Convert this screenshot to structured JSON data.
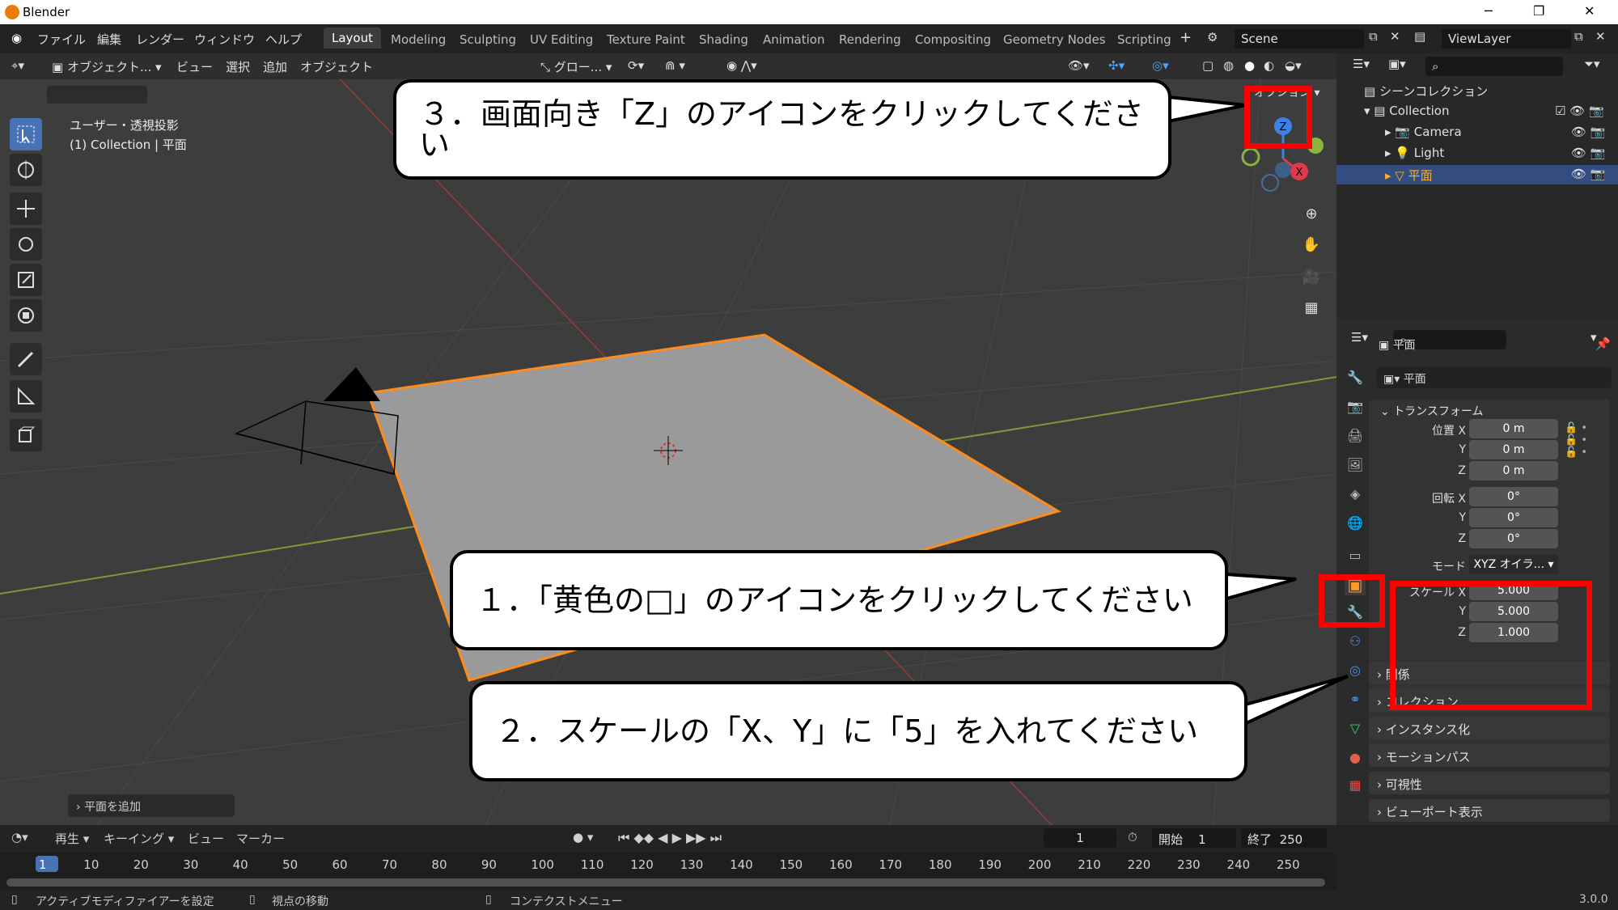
{
  "titlebar": {
    "title": "Blender",
    "minimize": "─",
    "maximize": "❐",
    "close": "✕"
  },
  "menu": [
    "ファイル",
    "編集",
    "レンダー",
    "ウィンドウ",
    "ヘルプ"
  ],
  "workspaces": [
    "Layout",
    "Modeling",
    "Sculpting",
    "UV Editing",
    "Texture Paint",
    "Shading",
    "Animation",
    "Rendering",
    "Compositing",
    "Geometry Nodes",
    "Scripting"
  ],
  "scene": "Scene",
  "view_layer": "ViewLayer",
  "viewport": {
    "mode": "オブジェクト...",
    "menus": [
      "ビュー",
      "選択",
      "追加",
      "オブジェクト"
    ],
    "orientation": "グロー...",
    "options": "オプション",
    "view_name": "ユーザー・透視投影",
    "collection_info": "(1) Collection | 平面",
    "last_op": "平面を追加",
    "gizmo": {
      "z": "Z",
      "x": "X"
    }
  },
  "outliner": {
    "root": "シーンコレクション",
    "collection": "Collection",
    "items": [
      "Camera",
      "Light",
      "平面"
    ]
  },
  "properties": {
    "object_name": "平面",
    "data_name": "平面",
    "transform": "トランスフォーム",
    "location_label": "位置 X",
    "rotation_label": "回転 X",
    "axis_y": "Y",
    "axis_z": "Z",
    "location": [
      "0 m",
      "0 m",
      "0 m"
    ],
    "rotation": [
      "0°",
      "0°",
      "0°"
    ],
    "mode_label": "モード",
    "mode_value": "XYZ オイラ...",
    "scale_label": "スケール X",
    "scale": [
      "5.000",
      "5.000",
      "1.000"
    ],
    "panels": [
      "関係",
      "コレクション",
      "インスタンス化",
      "モーションパス",
      "可視性",
      "ビューポート表示"
    ]
  },
  "timeline": {
    "menus": [
      "再生",
      "キーイング",
      "ビュー",
      "マーカー"
    ],
    "current_frame": "1",
    "start_label": "開始",
    "start": "1",
    "end_label": "終了",
    "end": "250",
    "ticks": [
      "1",
      "10",
      "20",
      "30",
      "40",
      "50",
      "60",
      "70",
      "80",
      "90",
      "100",
      "110",
      "120",
      "130",
      "140",
      "150",
      "160",
      "170",
      "180",
      "190",
      "200",
      "210",
      "220",
      "230",
      "240",
      "250"
    ]
  },
  "statusbar": {
    "left": "アクティブモディファイアーを設定",
    "middle": "視点の移動",
    "right": "コンテクストメニュー",
    "version": "3.0.0"
  },
  "callouts": {
    "step1": "１．「黄色の□」のアイコンをクリックしてください",
    "step2": "２．スケールの「X、Y」に「5」を入れてください",
    "step3": "３．画面向き「Z」のアイコンをクリックしてください"
  },
  "colors": {
    "accent": "#4772b3",
    "selection": "#ff8c1a",
    "highlight": "#ff0000"
  }
}
